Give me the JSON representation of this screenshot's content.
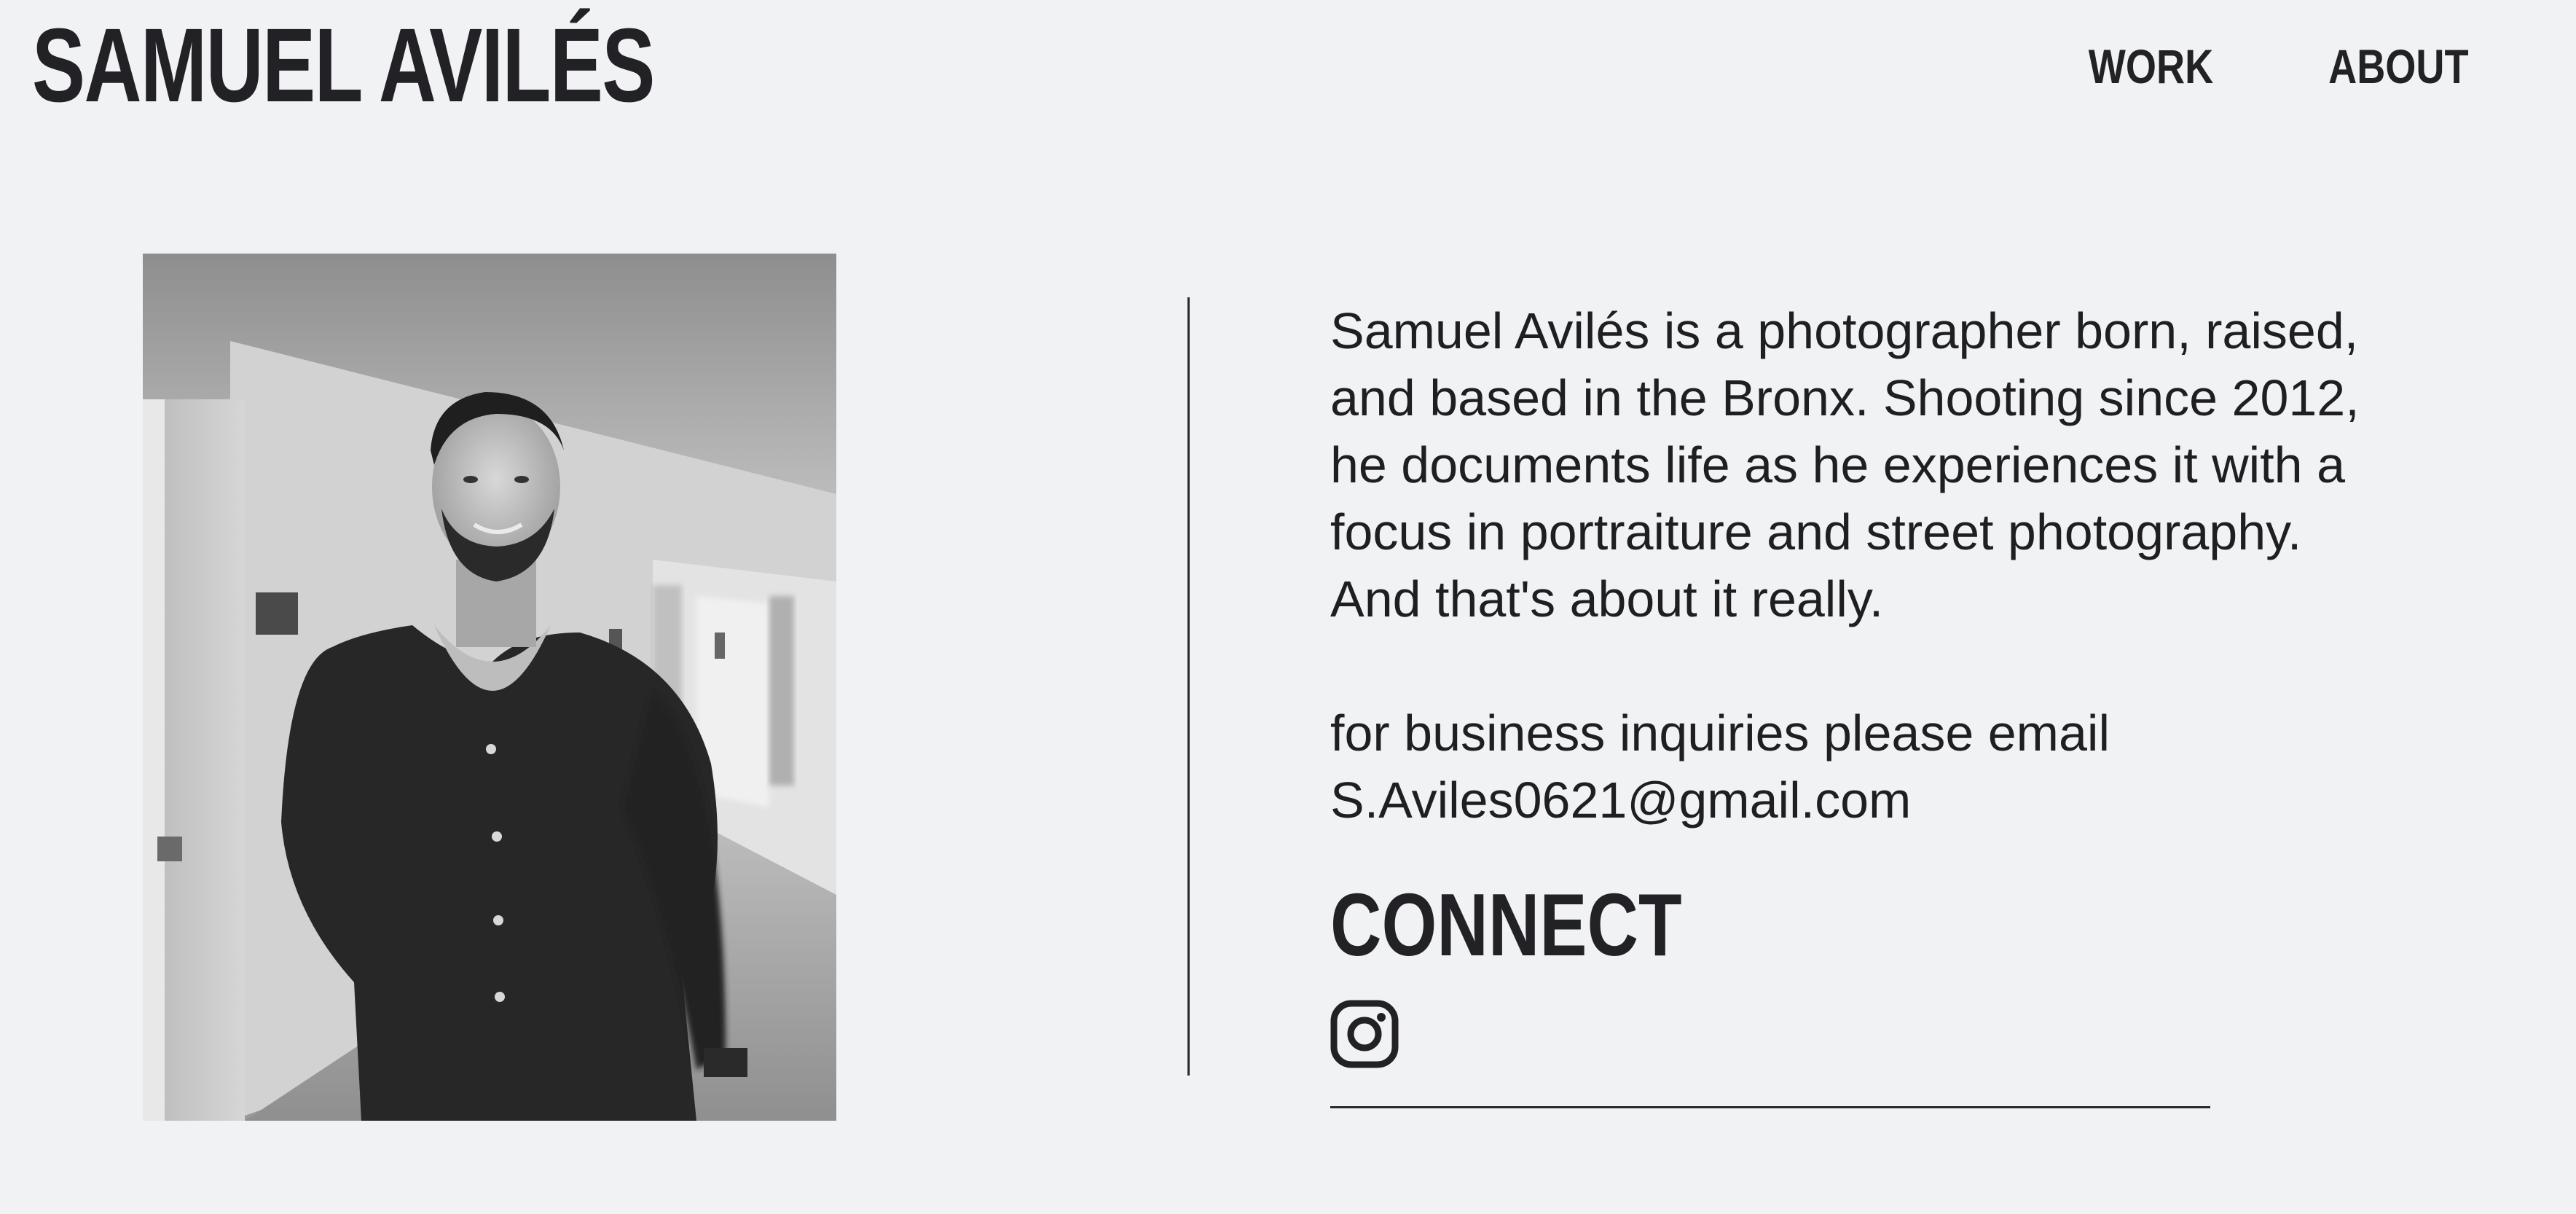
{
  "header": {
    "site_title": "SAMUEL AVILÉS",
    "nav": [
      {
        "label": "WORK"
      },
      {
        "label": "ABOUT"
      }
    ]
  },
  "portrait": {
    "alt": "Black and white portrait photo of a man in a hallway"
  },
  "about": {
    "bio_lines": [
      "Samuel Avilés is a photographer born, raised,",
      "and based in the Bronx. Shooting since 2012,",
      "he documents life as he experiences it with a",
      "focus in portraiture and street photography.",
      "And that's about it really."
    ],
    "inquiry_line": "for business inquiries please email",
    "email": "S.Aviles0621@gmail.com"
  },
  "connect": {
    "heading": "CONNECT",
    "social_icon": "instagram-icon"
  },
  "colors": {
    "background": "#f1f2f4",
    "text": "#222226",
    "rule": "#2a2a2e"
  }
}
